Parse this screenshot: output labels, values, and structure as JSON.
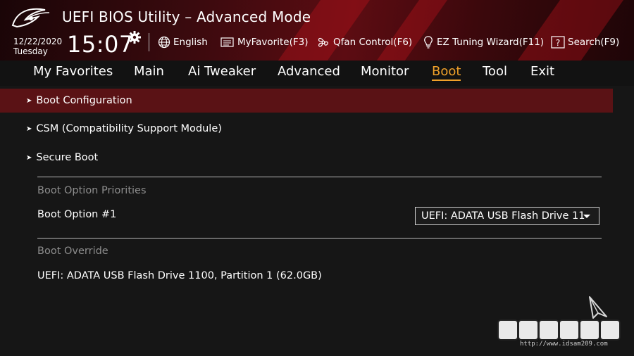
{
  "header": {
    "title": "UEFI BIOS Utility – Advanced Mode",
    "date": "12/22/2020",
    "day": "Tuesday",
    "time": "15:07",
    "toolbar": {
      "language": "English",
      "myfavorite": "MyFavorite(F3)",
      "qfan": "Qfan Control(F6)",
      "ez_tuning": "EZ Tuning Wizard(F11)",
      "search": "Search(F9)"
    }
  },
  "tabs": [
    {
      "label": "My Favorites"
    },
    {
      "label": "Main"
    },
    {
      "label": "Ai Tweaker"
    },
    {
      "label": "Advanced"
    },
    {
      "label": "Monitor"
    },
    {
      "label": "Boot"
    },
    {
      "label": "Tool"
    },
    {
      "label": "Exit"
    }
  ],
  "active_tab": "Boot",
  "content": {
    "submenus": [
      {
        "label": "Boot Configuration"
      },
      {
        "label": "CSM (Compatibility Support Module)"
      },
      {
        "label": "Secure Boot"
      }
    ],
    "boot_option_priorities_label": "Boot Option Priorities",
    "boot_option_1_label": "Boot Option #1",
    "boot_option_1_value": "UEFI: ADATA USB Flash Drive 11",
    "boot_override_label": "Boot Override",
    "boot_override_item": "UEFI: ADATA USB Flash Drive 1100, Partition 1 (62.0GB)"
  },
  "watermark": {
    "url": "http://www.idsam209.com"
  },
  "colors": {
    "accent": "#f0a12a",
    "selected_row": "#5a1215",
    "background": "#161616"
  }
}
